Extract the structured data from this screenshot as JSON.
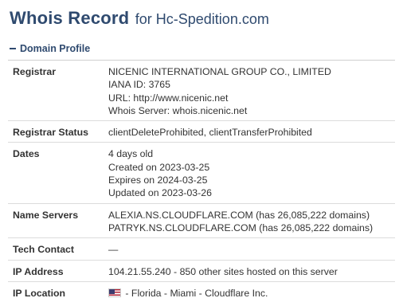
{
  "header": {
    "title": "Whois Record",
    "subtitle": "for Hc-Spedition.com"
  },
  "section": {
    "label": "Domain Profile",
    "icon": "minus-icon"
  },
  "rows": {
    "registrar": {
      "label": "Registrar",
      "lines": [
        "NICENIC INTERNATIONAL GROUP CO., LIMITED",
        "IANA ID: 3765",
        "URL: http://www.nicenic.net",
        "Whois Server: whois.nicenic.net"
      ]
    },
    "status": {
      "label": "Registrar Status",
      "lines": [
        "clientDeleteProhibited, clientTransferProhibited"
      ]
    },
    "dates": {
      "label": "Dates",
      "lines": [
        "4 days old",
        "Created on 2023-03-25",
        "Expires on 2024-03-25",
        "Updated on 2023-03-26"
      ]
    },
    "nameservers": {
      "label": "Name Servers",
      "lines": [
        "ALEXIA.NS.CLOUDFLARE.COM (has 26,085,222 domains)",
        "PATRYK.NS.CLOUDFLARE.COM (has 26,085,222 domains)"
      ]
    },
    "tech": {
      "label": "Tech Contact",
      "lines": [
        "—"
      ]
    },
    "ip": {
      "label": "IP Address",
      "lines": [
        "104.21.55.240 - 850 other sites hosted on this server"
      ]
    },
    "location": {
      "label": "IP Location",
      "flag": "us-flag-icon",
      "text": " - Florida - Miami - Cloudflare Inc."
    }
  }
}
